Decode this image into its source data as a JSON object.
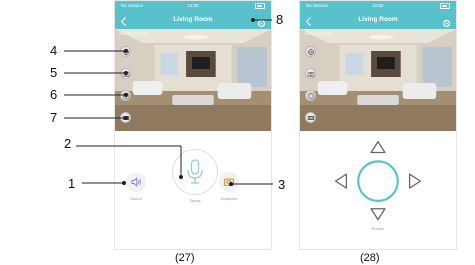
{
  "screens": [
    {
      "status": {
        "carrier": "No Service",
        "time": "11:50"
      },
      "title": "Living Room",
      "timestamp": "2017-03-22 15:08",
      "controls": {
        "sound_label": "Sound",
        "speak_label": "Speak",
        "snapshot_label": "Snapshot"
      },
      "caption": "(27)"
    },
    {
      "status": {
        "carrier": "No Service",
        "time": "11:50"
      },
      "title": "Living Room",
      "timestamp": "2017-03-22 15:08",
      "rocker_label": "Rocker",
      "caption": "(28)"
    }
  ],
  "callouts": [
    "1",
    "2",
    "3",
    "4",
    "5",
    "6",
    "7",
    "8"
  ],
  "colors": {
    "accent": "#58c2cc",
    "snapshot": "#f08a2a",
    "rocker": "#57c1cc"
  }
}
